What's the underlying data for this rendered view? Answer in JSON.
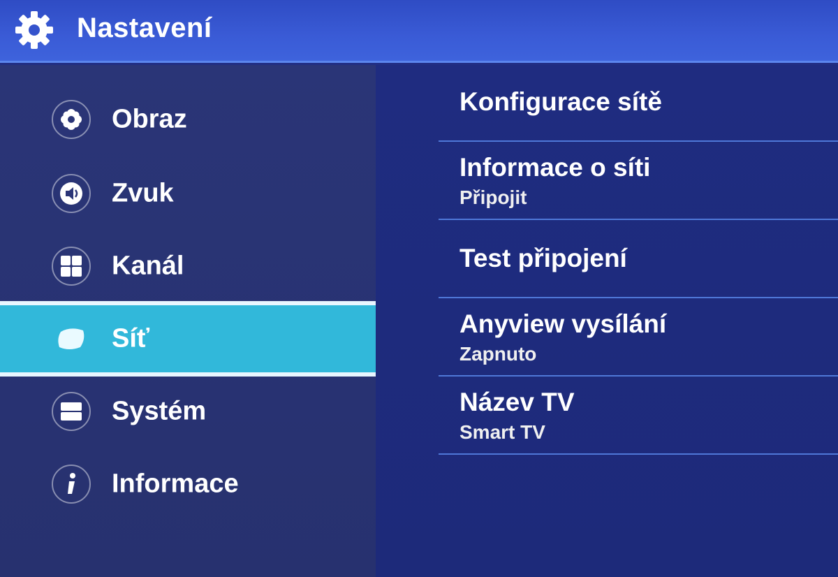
{
  "header": {
    "title": "Nastavení",
    "icon": "gear-icon"
  },
  "sidebar": {
    "items": [
      {
        "label": "Obraz",
        "icon": "flower-icon",
        "selected": false
      },
      {
        "label": "Zvuk",
        "icon": "speaker-icon",
        "selected": false
      },
      {
        "label": "Kanál",
        "icon": "grid-icon",
        "selected": false
      },
      {
        "label": "Síť",
        "icon": "network-icon",
        "selected": true
      },
      {
        "label": "Systém",
        "icon": "system-icon",
        "selected": false
      },
      {
        "label": "Informace",
        "icon": "info-icon",
        "selected": false
      }
    ]
  },
  "network_options": [
    {
      "title": "Konfigurace sítě",
      "value": ""
    },
    {
      "title": "Informace o síti",
      "value": "Připojit"
    },
    {
      "title": "Test připojení",
      "value": ""
    },
    {
      "title": "Anyview vysílání",
      "value": "Zapnuto"
    },
    {
      "title": "Název TV",
      "value": "Smart TV"
    }
  ],
  "colors": {
    "header_bg": "#3a5bd6",
    "selected_bg": "#31b8da",
    "divider": "#4f78d8",
    "panel_bg": "#1f2c80"
  }
}
